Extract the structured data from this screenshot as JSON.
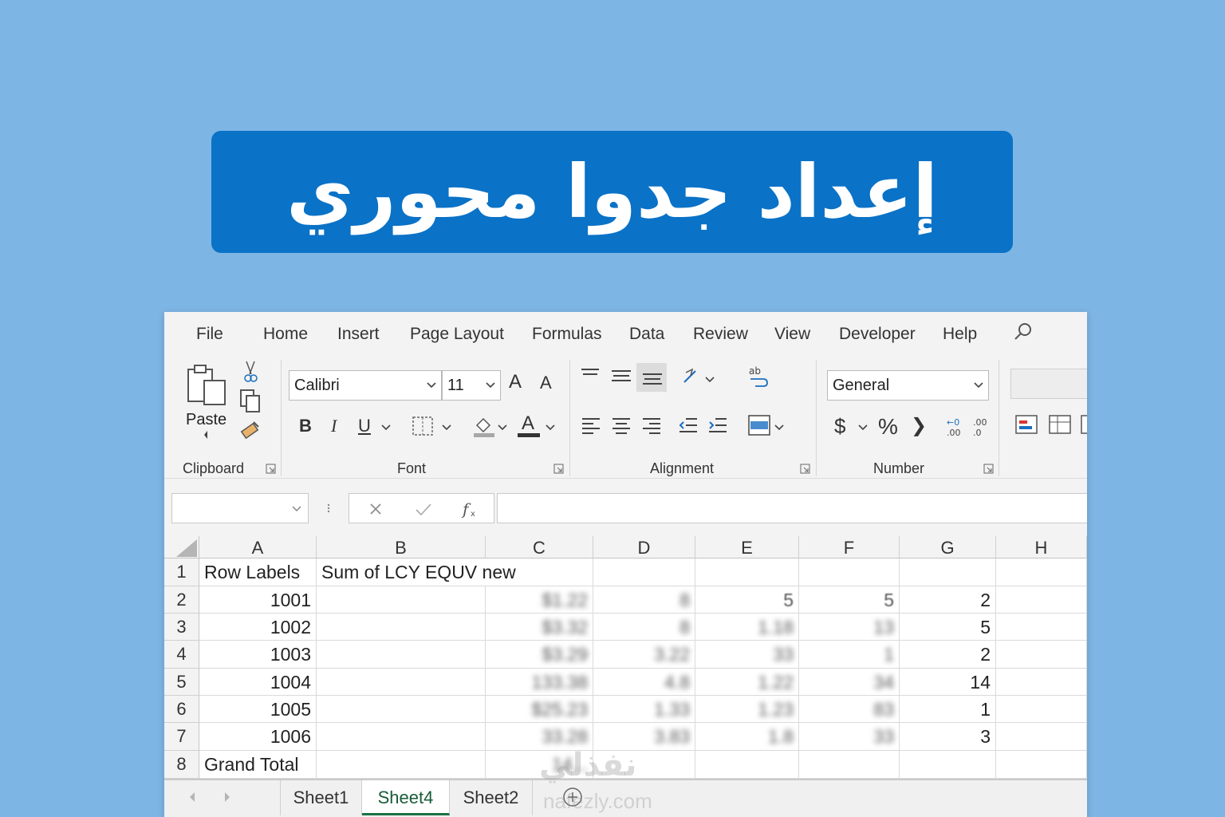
{
  "banner": {
    "title": "إعداد جدوا محوري"
  },
  "menu": [
    "File",
    "Home",
    "Insert",
    "Page Layout",
    "Formulas",
    "Data",
    "Review",
    "View",
    "Developer",
    "Help"
  ],
  "ribbon": {
    "paste_label": "Paste",
    "font_name": "Calibri",
    "font_size": "11",
    "number_format": "General",
    "groups": [
      "Clipboard",
      "Font",
      "Alignment",
      "Number"
    ],
    "bold": "B",
    "italic": "I",
    "underline": "U",
    "grow_font": "A",
    "shrink_font": "A",
    "font_color": "A",
    "currency": "$",
    "percent": "%",
    "comma": "❯"
  },
  "grid": {
    "columns": [
      "A",
      "B",
      "C",
      "D",
      "E",
      "F",
      "G",
      "H"
    ],
    "rows": [
      "1",
      "2",
      "3",
      "4",
      "5",
      "6",
      "7",
      "8"
    ],
    "cells": {
      "A1": "Row Labels",
      "B1": "Sum of LCY EQUV new",
      "A2": "1001",
      "A3": "1002",
      "A4": "1003",
      "A5": "1004",
      "A6": "1005",
      "A7": "1006",
      "A8": "Grand Total",
      "C2": "$1.22",
      "D2": "8",
      "E2": "5",
      "F2": "5",
      "G2": "2",
      "C3": "$3.32",
      "D3": "8",
      "E3": "1.18",
      "F3": "13",
      "G3": "5",
      "C4": "$3.29",
      "D4": "3.22",
      "E4": "33",
      "F4": "1",
      "G4": "2",
      "C5": "133.38",
      "D5": "4.8",
      "E5": "1.22",
      "F5": "34",
      "G5": "14",
      "C6": "$25.23",
      "D6": "1.33",
      "E6": "1.23",
      "F6": "83",
      "G6": "1",
      "C7": "33.28",
      "D7": "3.83",
      "E7": "1.8",
      "F7": "33",
      "G7": "3",
      "C8": "14..."
    }
  },
  "sheets": [
    "Sheet1",
    "Sheet4",
    "Sheet2"
  ],
  "active_sheet": "Sheet4",
  "add_sheet": "+",
  "watermark": {
    "name": "نفذلي",
    "url": "nafezly.com"
  },
  "colors": {
    "background": "#7db5e4",
    "banner": "#0a72c7",
    "accent": "#1e7145"
  }
}
